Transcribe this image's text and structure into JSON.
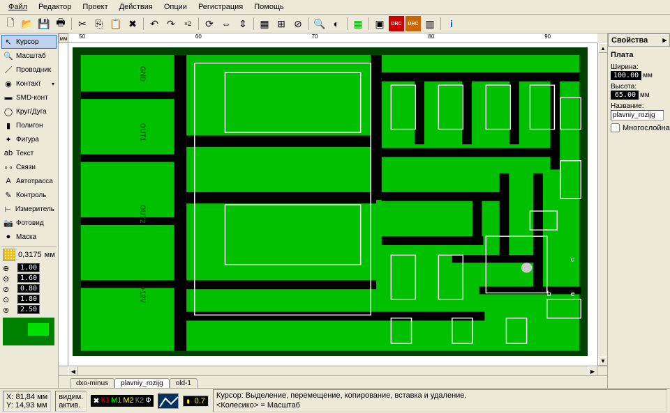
{
  "menu": {
    "items": [
      "Файл",
      "Редактор",
      "Проект",
      "Действия",
      "Опции",
      "Регистрация",
      "Помощь"
    ]
  },
  "toolbar": {
    "icons": [
      "new",
      "open",
      "save",
      "print",
      "|",
      "cut",
      "copy",
      "paste",
      "delete",
      "|",
      "undo",
      "redo",
      "x2",
      "|",
      "rotate",
      "mirror-h",
      "mirror-v",
      "|",
      "group",
      "ungroup",
      "|",
      "zoom",
      "contrast",
      "|",
      "tile",
      "|",
      "chip",
      "drc",
      "drc2",
      "bars",
      "|",
      "info"
    ]
  },
  "left_tools": [
    {
      "icon": "↖",
      "label": "Курсор",
      "sel": true
    },
    {
      "icon": "🔍",
      "label": "Масштаб"
    },
    {
      "icon": "／",
      "label": "Проводник"
    },
    {
      "icon": "◉",
      "label": "Контакт",
      "dd": true
    },
    {
      "icon": "▬",
      "label": "SMD-конт"
    },
    {
      "icon": "◯",
      "label": "Круг/Дуга"
    },
    {
      "icon": "▮",
      "label": "Полигон"
    },
    {
      "icon": "✦",
      "label": "Фигура"
    },
    {
      "icon": "ab",
      "label": "Текст"
    },
    {
      "icon": "∘∘",
      "label": "Связи"
    },
    {
      "icon": "A",
      "label": "Автотрасса"
    },
    {
      "icon": "✎",
      "label": "Контроль"
    },
    {
      "icon": "⊢",
      "label": "Измеритель"
    },
    {
      "icon": "📷",
      "label": "Фотовид"
    },
    {
      "icon": "●",
      "label": "Маска"
    }
  ],
  "grid": {
    "value": "0,3175",
    "unit": "мм"
  },
  "params": [
    {
      "icon": "t1",
      "value": "1.00"
    },
    {
      "icon": "t2",
      "value": "1.60"
    },
    {
      "icon": "t3",
      "value": "0.80"
    },
    {
      "icon": "t4",
      "value": "1.80"
    },
    {
      "icon": "t5",
      "value": "2.50"
    }
  ],
  "ruler": {
    "unit": "мм",
    "ticks": [
      "50",
      "60",
      "70",
      "80",
      "90"
    ]
  },
  "pcb_labels": [
    "GND",
    "OUT1",
    "OUT2",
    "+12V"
  ],
  "pcb_pins": {
    "c": "c",
    "b": "b",
    "e": "e"
  },
  "tabs": [
    {
      "label": "dxo-minus",
      "active": false
    },
    {
      "label": "plavniy_rozijg",
      "active": true
    },
    {
      "label": "old-1",
      "active": false
    }
  ],
  "props": {
    "title": "Свойства",
    "section": "Плата",
    "width_label": "Ширина:",
    "width_val": "100.00",
    "height_label": "Высота:",
    "height_val": "65.00",
    "unit": "мм",
    "name_label": "Название:",
    "name_val": "plavniy_rozijg",
    "multilayer": "Многослойная"
  },
  "status": {
    "x_label": "X:",
    "x": "81,84",
    "y_label": "Y:",
    "y": "14,93",
    "unit": "мм",
    "vidim": "видим.",
    "aktiv": "актив.",
    "layers": {
      "k1": "К1",
      "m1": "М1",
      "m2": "М2",
      "k2": "К2",
      "f": "Ф"
    },
    "mini": "0.7",
    "hint_line1": "Курсор: Выделение, перемещение, копирование, вставка и удаление.",
    "hint_line2": "<Колесико> = Масштаб"
  }
}
